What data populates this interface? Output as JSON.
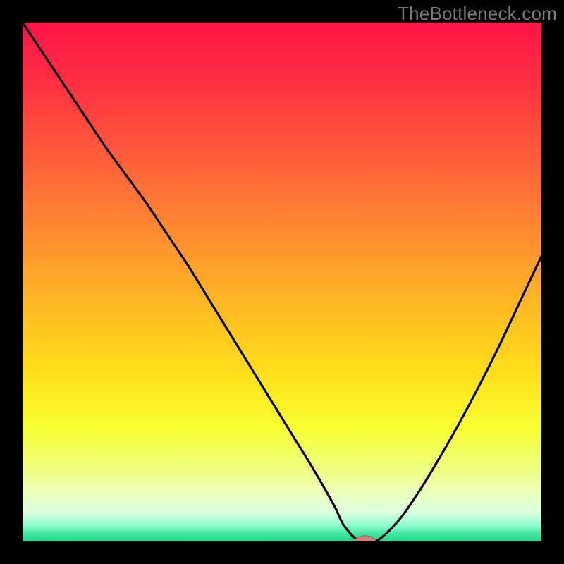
{
  "watermark": "TheBottleneck.com",
  "colors": {
    "frame": "#000000",
    "curve": "#000000",
    "marker_fill": "#d87d7d",
    "marker_stroke": "#b05050",
    "gradient_stops": [
      {
        "offset": 0.0,
        "color": "#ff1447"
      },
      {
        "offset": 0.1,
        "color": "#ff2b42"
      },
      {
        "offset": 0.25,
        "color": "#ff5a3a"
      },
      {
        "offset": 0.4,
        "color": "#ff8a30"
      },
      {
        "offset": 0.55,
        "color": "#ffbb22"
      },
      {
        "offset": 0.68,
        "color": "#ffe01a"
      },
      {
        "offset": 0.78,
        "color": "#f7ff30"
      },
      {
        "offset": 0.86,
        "color": "#f0ff80"
      },
      {
        "offset": 0.91,
        "color": "#ecffc0"
      },
      {
        "offset": 0.945,
        "color": "#d8ffe0"
      },
      {
        "offset": 0.97,
        "color": "#88ffd0"
      },
      {
        "offset": 0.985,
        "color": "#40e8a0"
      },
      {
        "offset": 1.0,
        "color": "#1fd88a"
      }
    ]
  },
  "chart_data": {
    "type": "line",
    "title": "",
    "xlabel": "",
    "ylabel": "",
    "xlim": [
      0,
      100
    ],
    "ylim": [
      0,
      100
    ],
    "x": [
      0,
      4,
      8,
      12,
      16,
      20,
      24,
      28,
      32,
      36,
      40,
      44,
      48,
      52,
      56,
      60,
      62,
      65,
      68,
      72,
      76,
      80,
      84,
      88,
      92,
      96,
      100
    ],
    "values": [
      100,
      94,
      88,
      82,
      76,
      70.5,
      65,
      59,
      53,
      46.5,
      40,
      33.5,
      27,
      20.5,
      14,
      7,
      3,
      0,
      0,
      3.5,
      9,
      15.5,
      22.5,
      30,
      38,
      46.5,
      55
    ],
    "marker": {
      "x": 66,
      "y": 0,
      "rx": 2.0,
      "ry": 1.1
    },
    "annotations": []
  }
}
